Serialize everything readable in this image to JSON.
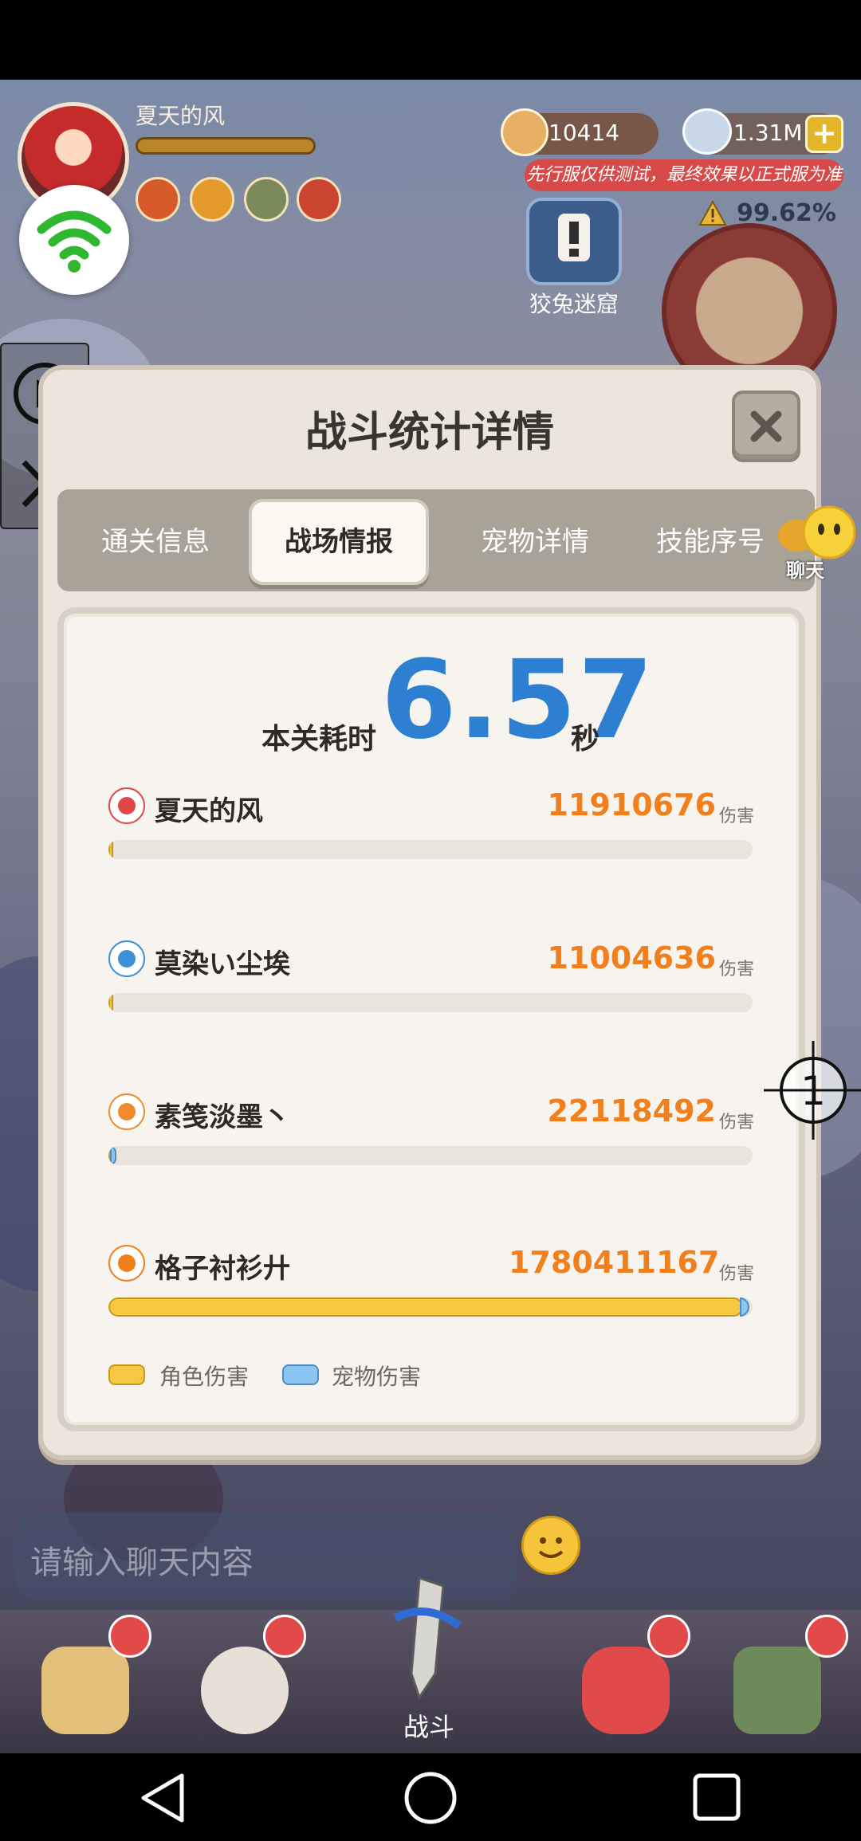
{
  "hud": {
    "player_name": "夏天的风",
    "gold": "10414",
    "gems": "1.31M",
    "gem_add": "+",
    "test_notice": "先行服仅供测试，最终效果以正式服为准",
    "percent": "99.62%",
    "maze_label": "狡兔迷窟"
  },
  "dialog": {
    "title": "战斗统计详情",
    "tabs": [
      "通关信息",
      "战场情报",
      "宠物详情",
      "技能序号"
    ],
    "active_tab": "战场情报",
    "chat_label": "聊天",
    "time_label": "本关耗时",
    "time_value": "6.57",
    "time_unit": "秒",
    "damage_unit": "伤害",
    "players": [
      {
        "name": "夏天的风",
        "damage": "11910676",
        "role_fraction": 0.005,
        "pet_fraction": 0.0,
        "icon": "red-crest-icon",
        "icon_color": "#e04848"
      },
      {
        "name": "莫染い尘埃",
        "damage": "11004636",
        "role_fraction": 0.005,
        "pet_fraction": 0.0,
        "icon": "blue-swirl-icon",
        "icon_color": "#3d8fd8"
      },
      {
        "name": "素笺淡墨丶",
        "damage": "22118492",
        "role_fraction": 0.002,
        "pet_fraction": 0.008,
        "icon": "orange-sword-icon",
        "icon_color": "#f08a2c"
      },
      {
        "name": "格子衬衫廾",
        "damage": "1780411167",
        "role_fraction": 0.985,
        "pet_fraction": 0.015,
        "icon": "flame-icon",
        "icon_color": "#f07f1c"
      }
    ],
    "legend": {
      "role": "角色伤害",
      "pet": "宠物伤害"
    }
  },
  "chat": {
    "placeholder": "请输入聊天内容"
  },
  "crosshair_label": "1",
  "bottom_nav": {
    "battle_label": "战斗"
  },
  "colors": {
    "accent_blue": "#2d7fd1",
    "damage_orange": "#f07f1c",
    "role_bar": "#f5c842",
    "pet_bar": "#8cc6f2"
  }
}
